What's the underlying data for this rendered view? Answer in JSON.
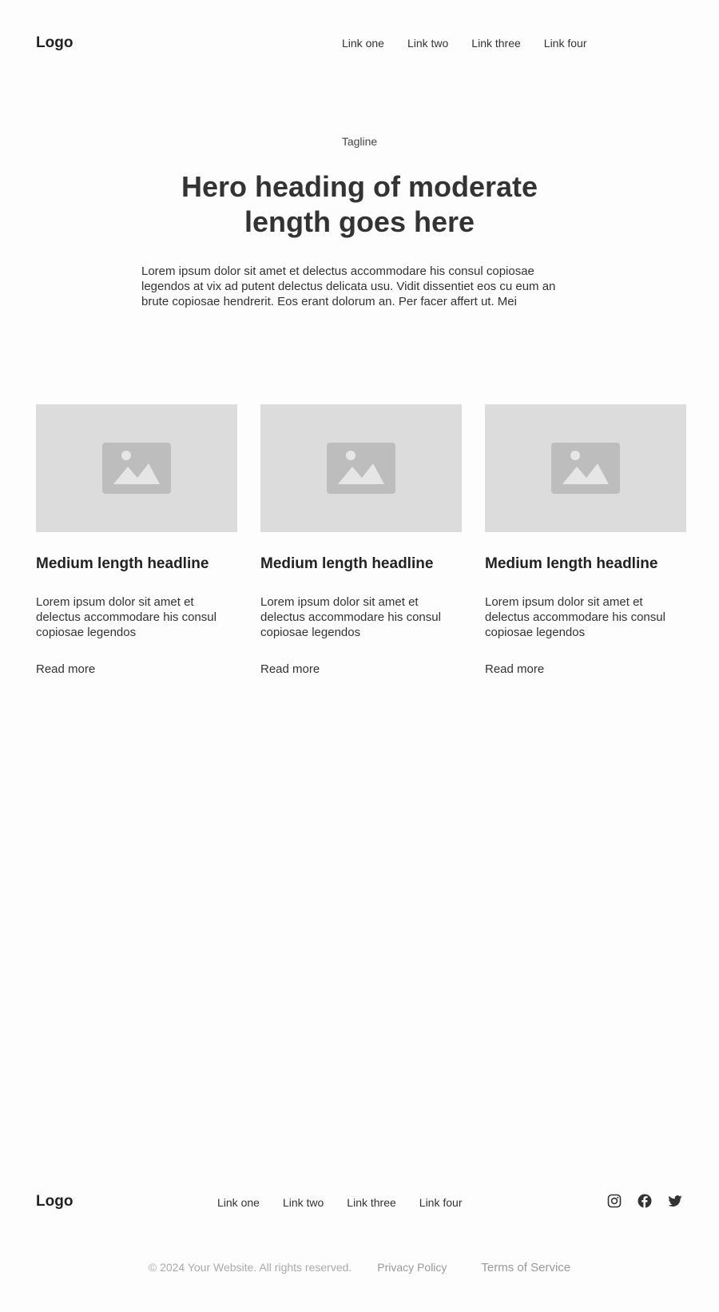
{
  "header": {
    "logo": "Logo",
    "nav": [
      "Link one",
      "Link two",
      "Link three",
      "Link four"
    ]
  },
  "hero": {
    "tagline": "Tagline",
    "heading": "Hero heading of moderate length goes here",
    "body": "Lorem ipsum dolor sit amet et delectus accommodare his consul copiosae legendos at vix ad putent delectus delicata usu. Vidit dissentiet eos cu eum an brute copiosae hendrerit. Eos erant dolorum an. Per facer affert ut. Mei"
  },
  "cards": [
    {
      "icon": "image-placeholder-icon",
      "title": "Medium length headline",
      "body": "Lorem ipsum dolor sit amet et delectus accommodare his consul copiosae legendos",
      "link": "Read more"
    },
    {
      "icon": "image-placeholder-icon",
      "title": "Medium length headline",
      "body": "Lorem ipsum dolor sit amet et delectus accommodare his consul copiosae legendos",
      "link": "Read more"
    },
    {
      "icon": "image-placeholder-icon",
      "title": "Medium length headline",
      "body": "Lorem ipsum dolor sit amet et delectus accommodare his consul copiosae legendos",
      "link": "Read more"
    }
  ],
  "footer": {
    "logo": "Logo",
    "nav": [
      "Link one",
      "Link two",
      "Link three",
      "Link four"
    ],
    "social": [
      "instagram-icon",
      "facebook-icon",
      "twitter-icon"
    ],
    "copyright": "© 2024 Your Website. All rights reserved.",
    "privacy": "Privacy Policy",
    "terms": "Terms of Service"
  },
  "colors": {
    "placeholder_bg": "#dcdcdc",
    "placeholder_icon": "#bdbdbd",
    "text": "#333333",
    "muted": "#aaaaaa"
  }
}
